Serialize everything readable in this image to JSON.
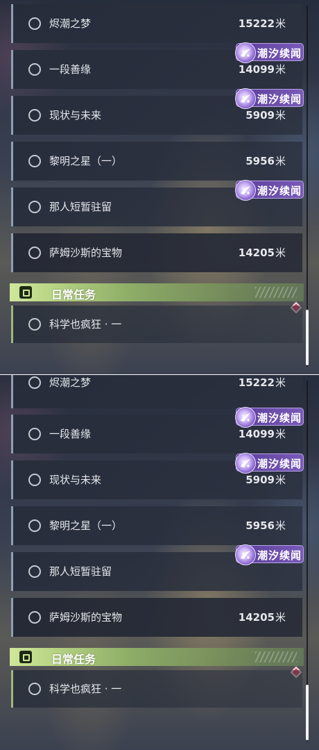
{
  "panels": [
    {
      "quests": [
        {
          "title": "烬潮之梦",
          "distance": "15222",
          "unit": "米"
        },
        {
          "title": "一段善缘",
          "distance": "14099",
          "unit": "米",
          "badge": "潮汐续闻"
        },
        {
          "title": "现状与未来",
          "distance": "5909",
          "unit": "米",
          "badge": "潮汐续闻"
        },
        {
          "title": "黎明之星（一）",
          "distance": "5956",
          "unit": "米"
        },
        {
          "title": "那人短暂驻留",
          "distance": "",
          "unit": "",
          "badge": "潮汐续闻"
        },
        {
          "title": "萨姆沙斯的宝物",
          "distance": "14205",
          "unit": "米"
        }
      ],
      "daily_header": "日常任务",
      "daily_items": [
        {
          "title": "科学也疯狂 · 一"
        }
      ]
    },
    {
      "quests": [
        {
          "title": "烬潮之梦",
          "distance": "15222",
          "unit": "米"
        },
        {
          "title": "一段善缘",
          "distance": "14099",
          "unit": "米",
          "badge": "潮汐续闻"
        },
        {
          "title": "现状与未来",
          "distance": "5909",
          "unit": "米",
          "badge": "潮汐续闻"
        },
        {
          "title": "黎明之星（一）",
          "distance": "5956",
          "unit": "米"
        },
        {
          "title": "那人短暂驻留",
          "distance": "",
          "unit": "",
          "badge": "潮汐续闻"
        },
        {
          "title": "萨姆沙斯的宝物",
          "distance": "14205",
          "unit": "米"
        }
      ],
      "daily_header": "日常任务",
      "daily_items": [
        {
          "title": "科学也疯狂 · 一"
        }
      ]
    }
  ],
  "colors": {
    "badge": "#6a4caa",
    "daily_accent": "#b8d685",
    "quest_bar": "#8ea0b4",
    "alert_diamond": "#d8405a"
  },
  "icons": {
    "quest_status": "circle-outline-icon",
    "badge": "tidal-story-emblem-icon",
    "daily": "exclamation-box-icon",
    "alert": "red-diamond-icon"
  }
}
